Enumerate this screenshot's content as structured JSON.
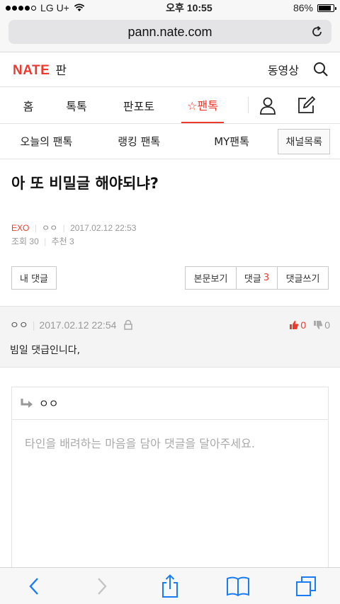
{
  "status": {
    "carrier": "LG U+",
    "time": "오후 10:55",
    "battery": "86%",
    "battery_level": 0.86
  },
  "browser": {
    "url": "pann.nate.com"
  },
  "header": {
    "logo": "NATE",
    "logo_suffix": "판",
    "video_label": "동영상"
  },
  "mainnav": {
    "tabs": [
      {
        "label": "홈"
      },
      {
        "label": "톡톡"
      },
      {
        "label": "판포토"
      },
      {
        "label": "☆팬톡"
      }
    ]
  },
  "subnav": {
    "items": [
      {
        "label": "오늘의 팬톡"
      },
      {
        "label": "랭킹 팬톡"
      },
      {
        "label": "MY팬톡"
      }
    ],
    "channel_button": "채널목록"
  },
  "article": {
    "title": "아 또 비밀글 해야되냐?",
    "category": "EXO",
    "author": "ㅇㅇ",
    "datetime": "2017.02.12 22:53",
    "views": "조회 30",
    "recommends": "추천 3"
  },
  "actions": {
    "my_comments": "내 댓글",
    "view_body": "본문보기",
    "comments_label": "댓글",
    "comments_count": "3",
    "write_comment": "댓글쓰기"
  },
  "comment": {
    "author": "ㅇㅇ",
    "datetime": "2017.02.12 22:54",
    "upvotes": "0",
    "downvotes": "0",
    "text": "빔일 댓급인니다,"
  },
  "reply": {
    "target": "ㅇㅇ",
    "placeholder": "타인을 배려하는 마음을 담아 댓글을 달아주세요."
  },
  "colors": {
    "accent": "#ec3a2e",
    "icon_blue": "#1a7cf5"
  },
  "icons": [
    "search-icon",
    "person-icon",
    "edit-icon",
    "lock-icon",
    "thumbs-up-icon",
    "thumbs-down-icon",
    "reply-arrow-icon",
    "back-icon",
    "forward-icon",
    "share-icon",
    "bookmarks-icon",
    "tabs-icon",
    "reload-icon",
    "wifi-icon"
  ]
}
